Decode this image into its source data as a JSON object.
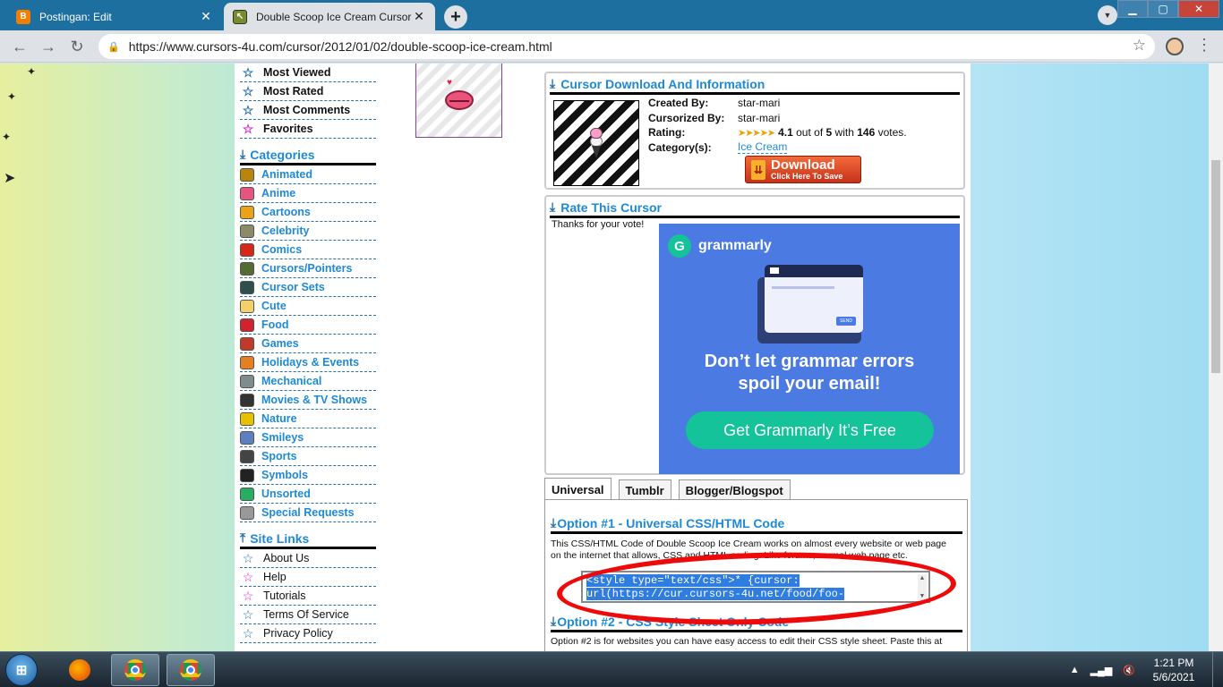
{
  "browser": {
    "tabs": [
      {
        "title": "Postingan: Edit",
        "favicon": "blogger-icon"
      },
      {
        "title": "Double Scoop Ice Cream Cursor",
        "favicon": "cursors4u-icon"
      }
    ],
    "new_tab": "+",
    "close_glyph": "✕",
    "url": "https://www.cursors-4u.com/cursor/2012/01/02/double-scoop-ice-cream.html"
  },
  "sidebar": {
    "top_items": [
      {
        "label": "Most Viewed",
        "color": "blue"
      },
      {
        "label": "Most Rated",
        "color": "blue"
      },
      {
        "label": "Most Comments",
        "color": "blue"
      },
      {
        "label": "Favorites",
        "color": "pink"
      }
    ],
    "categories_heading": "Categories",
    "categories": [
      {
        "label": "Animated",
        "color": "#b8860b"
      },
      {
        "label": "Anime",
        "color": "#e75480"
      },
      {
        "label": "Cartoons",
        "color": "#e8a317"
      },
      {
        "label": "Celebrity",
        "color": "#8b8b6a"
      },
      {
        "label": "Comics",
        "color": "#d62718"
      },
      {
        "label": "Cursors/Pointers",
        "color": "#556b2f"
      },
      {
        "label": "Cursor Sets",
        "color": "#2f4f4f"
      },
      {
        "label": "Cute",
        "color": "#f2d16b"
      },
      {
        "label": "Food",
        "color": "#d2222d"
      },
      {
        "label": "Games",
        "color": "#c0392b"
      },
      {
        "label": "Holidays & Events",
        "color": "#e67e22"
      },
      {
        "label": "Mechanical",
        "color": "#7f8c8d"
      },
      {
        "label": "Movies & TV Shows",
        "color": "#333333"
      },
      {
        "label": "Nature",
        "color": "#e5c100"
      },
      {
        "label": "Smileys",
        "color": "#5b7fbf"
      },
      {
        "label": "Sports",
        "color": "#444444"
      },
      {
        "label": "Symbols",
        "color": "#222222"
      },
      {
        "label": "Unsorted",
        "color": "#27ae60"
      },
      {
        "label": "Special Requests",
        "color": "#999999"
      }
    ],
    "site_links_heading": "Site Links",
    "site_links": [
      {
        "label": "About Us",
        "color": "blue"
      },
      {
        "label": "Help",
        "color": "pink"
      },
      {
        "label": "Tutorials",
        "color": "pink"
      },
      {
        "label": "Terms Of Service",
        "color": "blue"
      },
      {
        "label": "Privacy Policy",
        "color": "blue"
      }
    ]
  },
  "info": {
    "title": "Cursor Download And Information",
    "created_by_label": "Created By:",
    "created_by": "star-mari",
    "cursorized_by_label": "Cursorized By:",
    "cursorized_by": "star-mari",
    "rating_label": "Rating:",
    "rating_value": "4.1",
    "rating_out_of": "out of",
    "rating_max": "5",
    "rating_with": "with",
    "votes": "146",
    "votes_suffix": "votes.",
    "category_label": "Category(s):",
    "category": "Ice Cream",
    "download_label": "Download",
    "download_sub": "Click Here To Save"
  },
  "rate": {
    "title": "Rate This Cursor",
    "thanks": "Thanks for your vote!"
  },
  "ad": {
    "brand": "grammarly",
    "send_label": "SEND",
    "headline_line1": "Don’t let grammar errors",
    "headline_line2": "spoil your email!",
    "cta": "Get Grammarly  It’s Free"
  },
  "code_tabs": [
    "Universal",
    "Tumblr",
    "Blogger/Blogspot"
  ],
  "option1": {
    "title": "Option #1 - Universal CSS/HTML Code",
    "desc_line1": "This CSS/HTML Code of Double Scoop Ice Cream works on almost every website or web page",
    "desc_line2": "on the internet that allows, CSS and HTML coding. Like forums, normal web page etc.",
    "code_line1": "<style type=\"text/css\">* {cursor:",
    "code_line2": "url(https://cur.cursors-4u.net/food/foo-"
  },
  "option2": {
    "title": "Option #2 - CSS Style Sheet Only Code",
    "desc": "Option #2 is for websites you can have easy access to edit their CSS style sheet. Paste this at"
  },
  "taskbar": {
    "time": "1:21 PM",
    "date": "5/6/2021"
  }
}
